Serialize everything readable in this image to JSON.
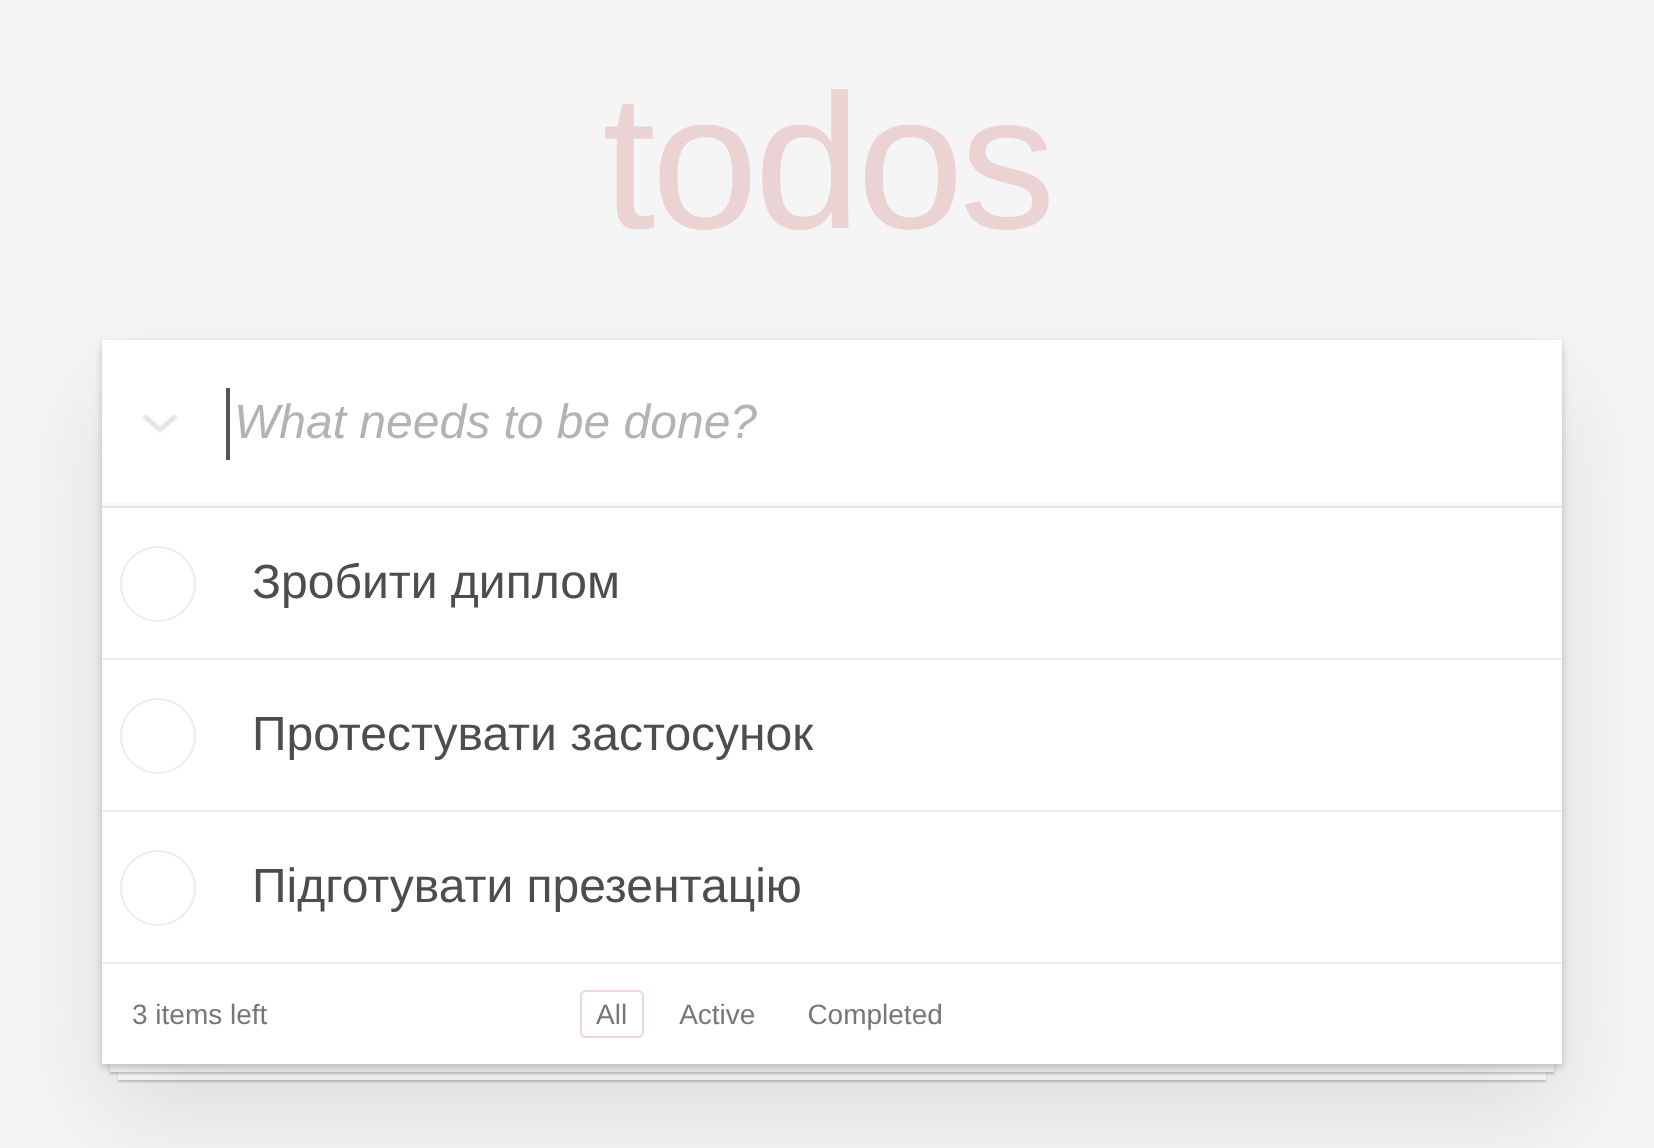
{
  "title": "todos",
  "new_todo": {
    "placeholder": "What needs to be done?"
  },
  "todos": [
    {
      "text": "Зробити диплом",
      "completed": false
    },
    {
      "text": "Протестувати застосунок",
      "completed": false
    },
    {
      "text": "Підготувати презентацію",
      "completed": false
    }
  ],
  "footer": {
    "count": "3 items left",
    "filters": [
      {
        "label": "All",
        "selected": true
      },
      {
        "label": "Active",
        "selected": false
      },
      {
        "label": "Completed",
        "selected": false
      }
    ]
  }
}
